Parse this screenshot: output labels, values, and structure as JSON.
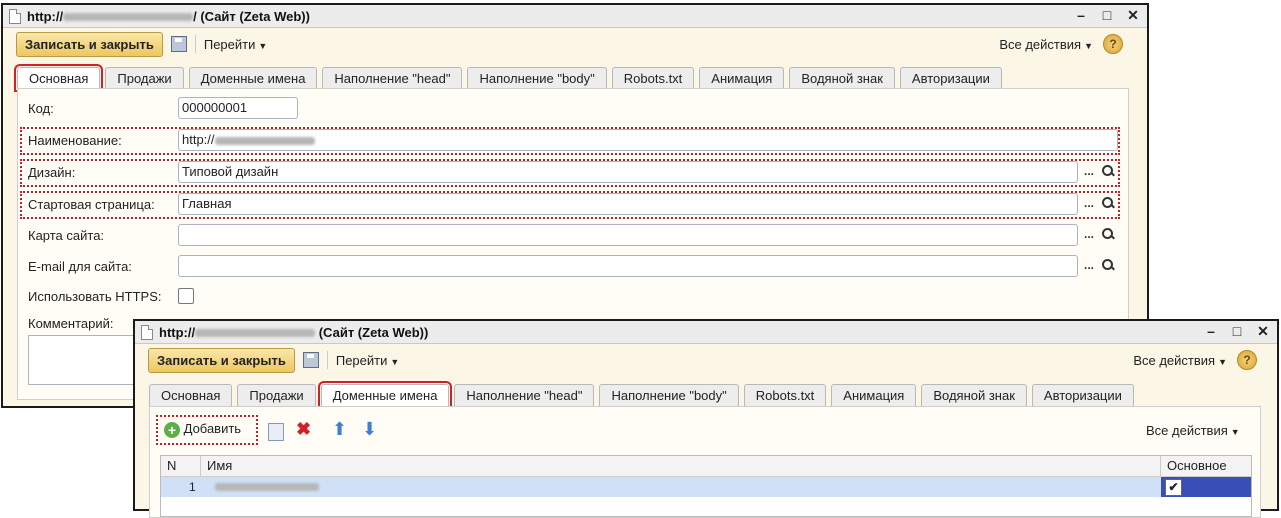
{
  "window1": {
    "title_prefix": "http://",
    "title_suffix": "/ (Сайт (Zeta Web))",
    "toolbar": {
      "save_close_label": "Записать и закрыть",
      "goto_label": "Перейти",
      "all_actions_label": "Все действия",
      "help_label": "?"
    },
    "tabs": [
      {
        "label": "Основная"
      },
      {
        "label": "Продажи"
      },
      {
        "label": "Доменные имена"
      },
      {
        "label": "Наполнение \"head\""
      },
      {
        "label": "Наполнение \"body\""
      },
      {
        "label": "Robots.txt"
      },
      {
        "label": "Анимация"
      },
      {
        "label": "Водяной знак"
      },
      {
        "label": "Авторизации"
      }
    ],
    "fields": {
      "code_label": "Код:",
      "code_value": "000000001",
      "name_label": "Наименование:",
      "name_value": "http://",
      "design_label": "Дизайн:",
      "design_value": "Типовой дизайн",
      "start_label": "Стартовая страница:",
      "start_value": "Главная",
      "sitemap_label": "Карта сайта:",
      "email_label": "E-mail для сайта:",
      "https_label": "Использовать HTTPS:",
      "comment_label": "Комментарий:"
    },
    "window_buttons": {
      "min": "–",
      "max": "□",
      "close": "✕"
    }
  },
  "window2": {
    "title_prefix": "http://",
    "title_suffix": "(Сайт (Zeta Web))",
    "toolbar": {
      "save_close_label": "Записать и закрыть",
      "goto_label": "Перейти",
      "all_actions_label": "Все действия",
      "help_label": "?"
    },
    "tabs": [
      {
        "label": "Основная"
      },
      {
        "label": "Продажи"
      },
      {
        "label": "Доменные имена"
      },
      {
        "label": "Наполнение \"head\""
      },
      {
        "label": "Наполнение \"body\""
      },
      {
        "label": "Robots.txt"
      },
      {
        "label": "Анимация"
      },
      {
        "label": "Водяной знак"
      },
      {
        "label": "Авторизации"
      }
    ],
    "list": {
      "add_label": "Добавить",
      "all_actions_label": "Все действия",
      "columns": [
        "N",
        "Имя",
        "Основное"
      ],
      "rows": [
        {
          "n": "1",
          "checked": "✔"
        }
      ]
    },
    "window_buttons": {
      "min": "–",
      "max": "□",
      "close": "✕"
    }
  }
}
